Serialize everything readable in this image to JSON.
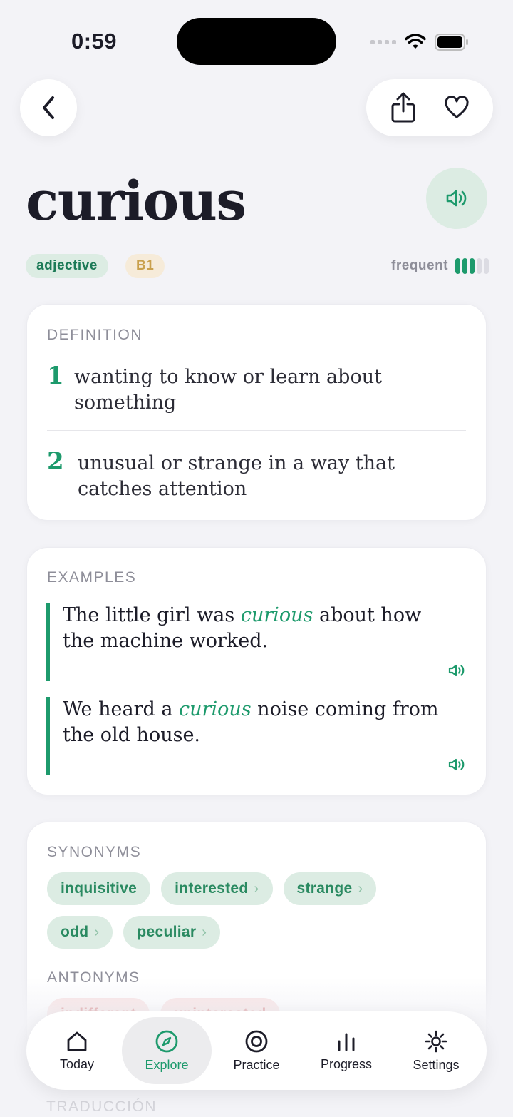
{
  "status_bar": {
    "time": "0:59"
  },
  "word": {
    "title": "curious",
    "part_of_speech": "adjective",
    "level": "B1",
    "frequency_label": "frequent",
    "frequency_level": 3,
    "frequency_max": 5
  },
  "definition": {
    "label": "DEFINITION",
    "items": [
      {
        "num": "1",
        "text": "wanting to know or learn about something"
      },
      {
        "num": "2",
        "text": "unusual or strange in a way that catches attention"
      }
    ]
  },
  "examples": {
    "label": "EXAMPLES",
    "items": [
      {
        "before": "The little girl was ",
        "highlight": "curious",
        "after": " about how the machine worked."
      },
      {
        "before": "We heard a ",
        "highlight": "curious",
        "after": " noise coming from the old house."
      }
    ]
  },
  "synonyms": {
    "label": "SYNONYMS",
    "items": [
      "inquisitive",
      "interested",
      "strange",
      "odd",
      "peculiar"
    ]
  },
  "antonyms": {
    "label": "ANTONYMS",
    "items": [
      "indifferent",
      "uninterested"
    ]
  },
  "next_section": {
    "label": "TRADUCCIÓN"
  },
  "tabbar": {
    "items": [
      "Today",
      "Explore",
      "Practice",
      "Progress",
      "Settings"
    ],
    "active": "Explore"
  },
  "colors": {
    "accent": "#1d9a6c",
    "accent_soft": "#dcece3",
    "level_bg": "#f6ebd9",
    "level_text": "#c9a04d",
    "antonym_bg": "#f9dddd"
  },
  "icons": [
    "back-icon",
    "share-icon",
    "heart-icon",
    "speaker-icon",
    "home-icon",
    "compass-icon",
    "target-icon",
    "chart-icon",
    "gear-icon"
  ]
}
